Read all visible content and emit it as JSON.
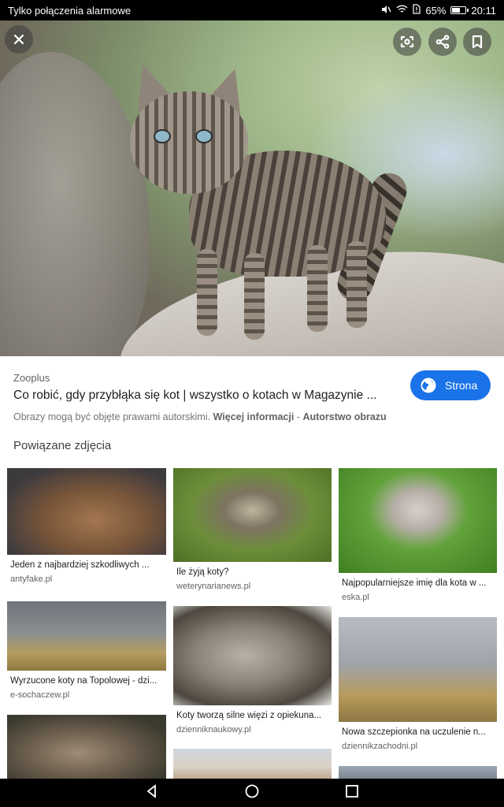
{
  "status_bar": {
    "carrier": "Tylko połączenia alarmowe",
    "battery": "65%",
    "time": "20:11"
  },
  "viewer": {
    "close_icon": "close-icon",
    "lens_icon": "lens-icon",
    "share_icon": "share-icon",
    "bookmark_icon": "bookmark-icon"
  },
  "info": {
    "source": "Zooplus",
    "title": "Co robić, gdy przybłąka się kot | wszystko o kotach w Magazynie ...",
    "button_label": "Strona",
    "copyright": "Obrazy mogą być objęte prawami autorskimi.",
    "more_info": "Więcej informacji",
    "separator": "-",
    "author": "Autorstwo obrazu"
  },
  "related": {
    "heading": "Powiązane zdjęcia",
    "items": [
      {
        "caption": "Jeden z najbardziej szkodliwych ...",
        "source": "antyfake.pl"
      },
      {
        "caption": "Ile żyją koty?",
        "source": "weterynarianews.pl"
      },
      {
        "caption": "Najpopularniejsze imię dla kota w ...",
        "source": "eska.pl"
      },
      {
        "caption": "Wyrzucone koty na Topolowej - dzi...",
        "source": "e-sochaczew.pl"
      },
      {
        "caption": "Koty tworzą silne więzi z opiekuna...",
        "source": "dzienniknaukowy.pl"
      },
      {
        "caption": "Nowa szczepionka na uczulenie n...",
        "source": "dziennikzachodni.pl"
      },
      {
        "caption": "",
        "source": ""
      },
      {
        "caption": "",
        "source": ""
      },
      {
        "caption": "",
        "source": ""
      }
    ]
  },
  "colors": {
    "accent": "#1a73e8",
    "text_primary": "#202124",
    "text_secondary": "#5f6368"
  }
}
